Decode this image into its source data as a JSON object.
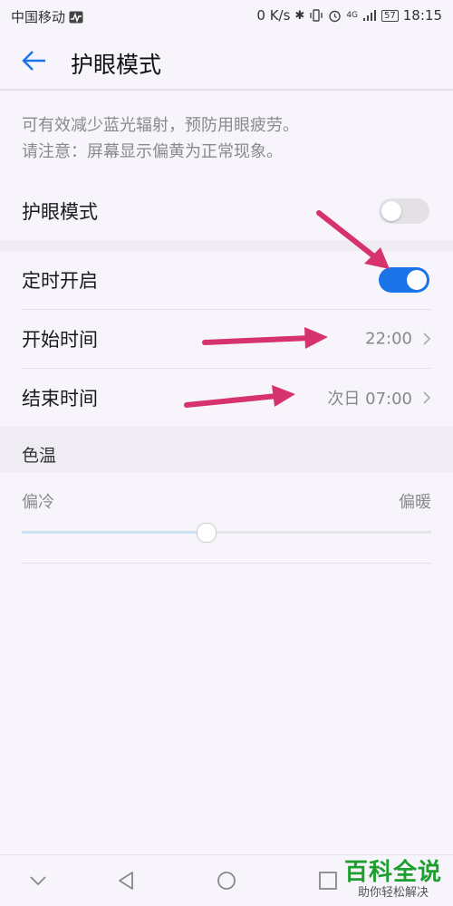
{
  "status_bar": {
    "carrier": "中国移动",
    "network_speed": "0 K/s",
    "battery_level": "57",
    "time": "18:15",
    "icons": [
      "activity-icon",
      "bluetooth-icon",
      "vibrate-icon",
      "alarm-icon",
      "4g-icon",
      "signal-icon",
      "battery-icon"
    ]
  },
  "header": {
    "title": "护眼模式",
    "back_icon": "back-arrow-icon",
    "accent_color": "#1a73e8"
  },
  "description": {
    "line1": "可有效减少蓝光辐射，预防用眼疲劳。",
    "line2": "请注意：屏幕显示偏黄为正常现象。"
  },
  "settings": {
    "eye_mode": {
      "label": "护眼模式",
      "enabled": false
    },
    "schedule": {
      "label": "定时开启",
      "enabled": true
    },
    "start_time": {
      "label": "开始时间",
      "value": "22:00"
    },
    "end_time": {
      "label": "结束时间",
      "value": "次日 07:00"
    }
  },
  "color_temp": {
    "section_title": "色温",
    "cool_label": "偏冷",
    "warm_label": "偏暖",
    "value_fraction": 0.45
  },
  "annotation_arrow_color": "#d6336c",
  "watermark": {
    "title": "百科全说",
    "subtitle": "助你轻松解决"
  }
}
